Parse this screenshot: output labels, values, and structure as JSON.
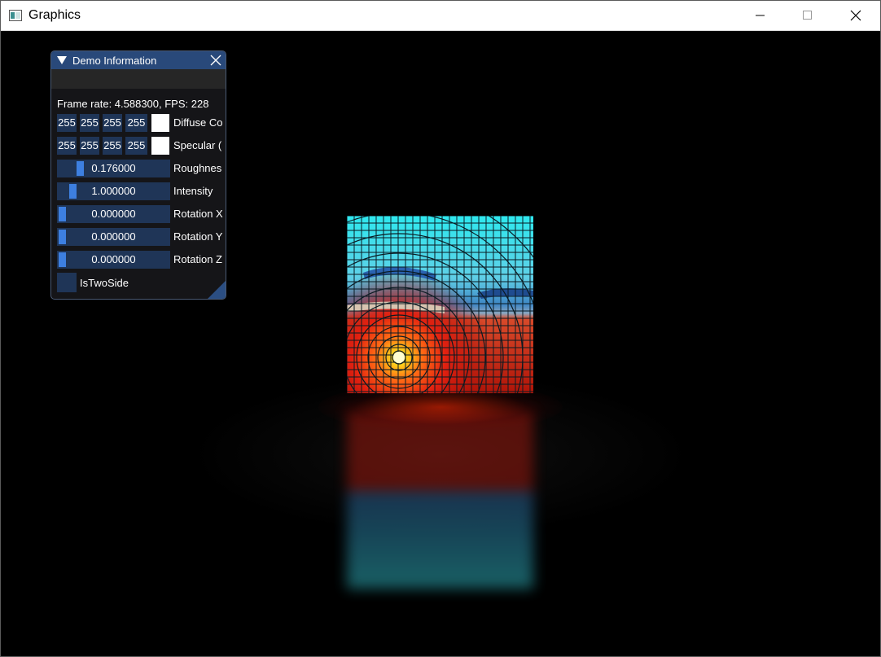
{
  "window": {
    "title": "Graphics",
    "icon": "app-window-icon",
    "controls": [
      "minimize-icon",
      "maximize-icon",
      "close-icon"
    ]
  },
  "demo_panel": {
    "title": "Demo Information",
    "frame_rate_text": "Frame rate: 4.588300, FPS: 228",
    "diffuse": {
      "r": "255",
      "g": "255",
      "b": "255",
      "a": "255",
      "label": "Diffuse Co",
      "swatch_color": "#ffffff"
    },
    "specular": {
      "r": "255",
      "g": "255",
      "b": "255",
      "a": "255",
      "label": "Specular (",
      "swatch_color": "#ffffff"
    },
    "roughness": {
      "value": "0.176000",
      "label": "Roughnes",
      "fraction": 0.176
    },
    "intensity": {
      "value": "1.000000",
      "label": "Intensity",
      "fraction": 0.1
    },
    "rotation_x": {
      "value": "0.000000",
      "label": "Rotation X",
      "fraction": 0.0
    },
    "rotation_y": {
      "value": "0.000000",
      "label": "Rotation Y",
      "fraction": 0.0
    },
    "rotation_z": {
      "value": "0.000000",
      "label": "Rotation Z",
      "fraction": 0.0
    },
    "two_side": {
      "label": "IsTwoSide",
      "checked": false
    }
  },
  "colors": {
    "title_bar": "#29497a",
    "frame_bg": "#1f3557",
    "slider_grab": "#3d7fe0"
  }
}
